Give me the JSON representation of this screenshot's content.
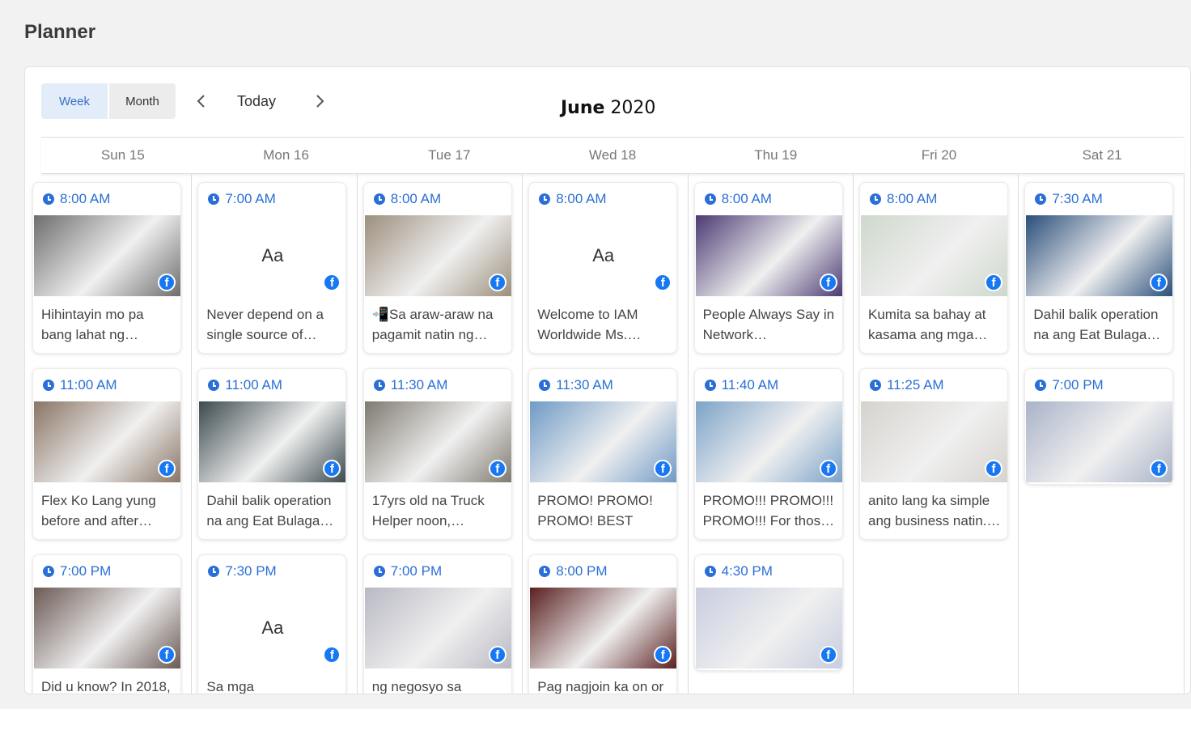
{
  "page_title": "Planner",
  "toolbar": {
    "week_label": "Week",
    "month_label": "Month",
    "today_label": "Today"
  },
  "calendar": {
    "month": "June",
    "year": "2020"
  },
  "days": [
    "Sun 15",
    "Mon 16",
    "Tue 17",
    "Wed 18",
    "Thu 19",
    "Fri 20",
    "Sat 21"
  ],
  "icons": {
    "clock": "clock-icon",
    "facebook": "facebook-icon",
    "prev": "chevron-left-icon",
    "next": "chevron-right-icon"
  },
  "colors": {
    "accent": "#2a6fd6",
    "facebook": "#1877f2",
    "active_tab_bg": "#e3ecf9"
  },
  "text_placeholder": "Aa",
  "fb_glyph": "f",
  "posts": [
    {
      "day": 0,
      "row": 0,
      "time": "8:00 AM",
      "caption": "Hihintayin mo pa bang lahat ng…",
      "thumb": "photo",
      "tone": "#6d6d6d"
    },
    {
      "day": 0,
      "row": 1,
      "time": "11:00 AM",
      "caption": "Flex Ko Lang yung before and after…",
      "thumb": "photo",
      "tone": "#8a7565"
    },
    {
      "day": 0,
      "row": 2,
      "time": "7:00 PM",
      "caption": "Did u know? In 2018,",
      "thumb": "photo",
      "tone": "#6b5a55"
    },
    {
      "day": 1,
      "row": 0,
      "time": "7:00 AM",
      "caption": "Never depend on a single source of…",
      "thumb": "text"
    },
    {
      "day": 1,
      "row": 1,
      "time": "11:00 AM",
      "caption": "Dahil balik operation na ang Eat Bulaga…",
      "thumb": "photo",
      "tone": "#3b4a4f"
    },
    {
      "day": 1,
      "row": 2,
      "time": "7:30 PM",
      "caption": "Sa mga EMPLOYEES",
      "thumb": "text"
    },
    {
      "day": 2,
      "row": 0,
      "time": "8:00 AM",
      "caption": "📲Sa araw-araw na pagamit natin ng…",
      "thumb": "photo",
      "tone": "#9c8f7d"
    },
    {
      "day": 2,
      "row": 1,
      "time": "11:30 AM",
      "caption": "17yrs old na Truck Helper noon,…",
      "thumb": "photo",
      "tone": "#7f7a70"
    },
    {
      "day": 2,
      "row": 2,
      "time": "7:00 PM",
      "caption": "ng negosyo sa",
      "thumb": "photo",
      "tone": "#b9b9c4"
    },
    {
      "day": 3,
      "row": 0,
      "time": "8:00 AM",
      "caption": "Welcome to IAM Worldwide Ms.…",
      "thumb": "text"
    },
    {
      "day": 3,
      "row": 1,
      "time": "11:30 AM",
      "caption": "PROMO! PROMO! PROMO! BEST TIM…",
      "thumb": "photo",
      "tone": "#6f9ac6"
    },
    {
      "day": 3,
      "row": 2,
      "time": "8:00 PM",
      "caption": "Pag nagjoin ka on or",
      "thumb": "photo",
      "tone": "#5a2020"
    },
    {
      "day": 4,
      "row": 0,
      "time": "8:00 AM",
      "caption": "People Always Say in Network…",
      "thumb": "photo",
      "tone": "#4b3a73"
    },
    {
      "day": 4,
      "row": 1,
      "time": "11:40 AM",
      "caption": "PROMO!!! PROMO!!! PROMO!!! For thos…",
      "thumb": "photo",
      "tone": "#7ca3c8"
    },
    {
      "day": 4,
      "row": 2,
      "time": "4:30 PM",
      "caption": "",
      "thumb": "photo",
      "tone": "#c8cde0"
    },
    {
      "day": 5,
      "row": 0,
      "time": "8:00 AM",
      "caption": "Kumita sa bahay at kasama ang mga…",
      "thumb": "photo",
      "tone": "#cfd8cc"
    },
    {
      "day": 5,
      "row": 1,
      "time": "11:25 AM",
      "caption": "anito lang ka simple ang business natin.…",
      "thumb": "photo",
      "tone": "#d6d3ce"
    },
    {
      "day": 6,
      "row": 0,
      "time": "7:30 AM",
      "caption": "Dahil balik operation na ang Eat Bulaga…",
      "thumb": "photo",
      "tone": "#2a4e7a"
    },
    {
      "day": 6,
      "row": 1,
      "time": "7:00 PM",
      "caption": "",
      "thumb": "photo",
      "tone": "#a9b3c8"
    }
  ]
}
